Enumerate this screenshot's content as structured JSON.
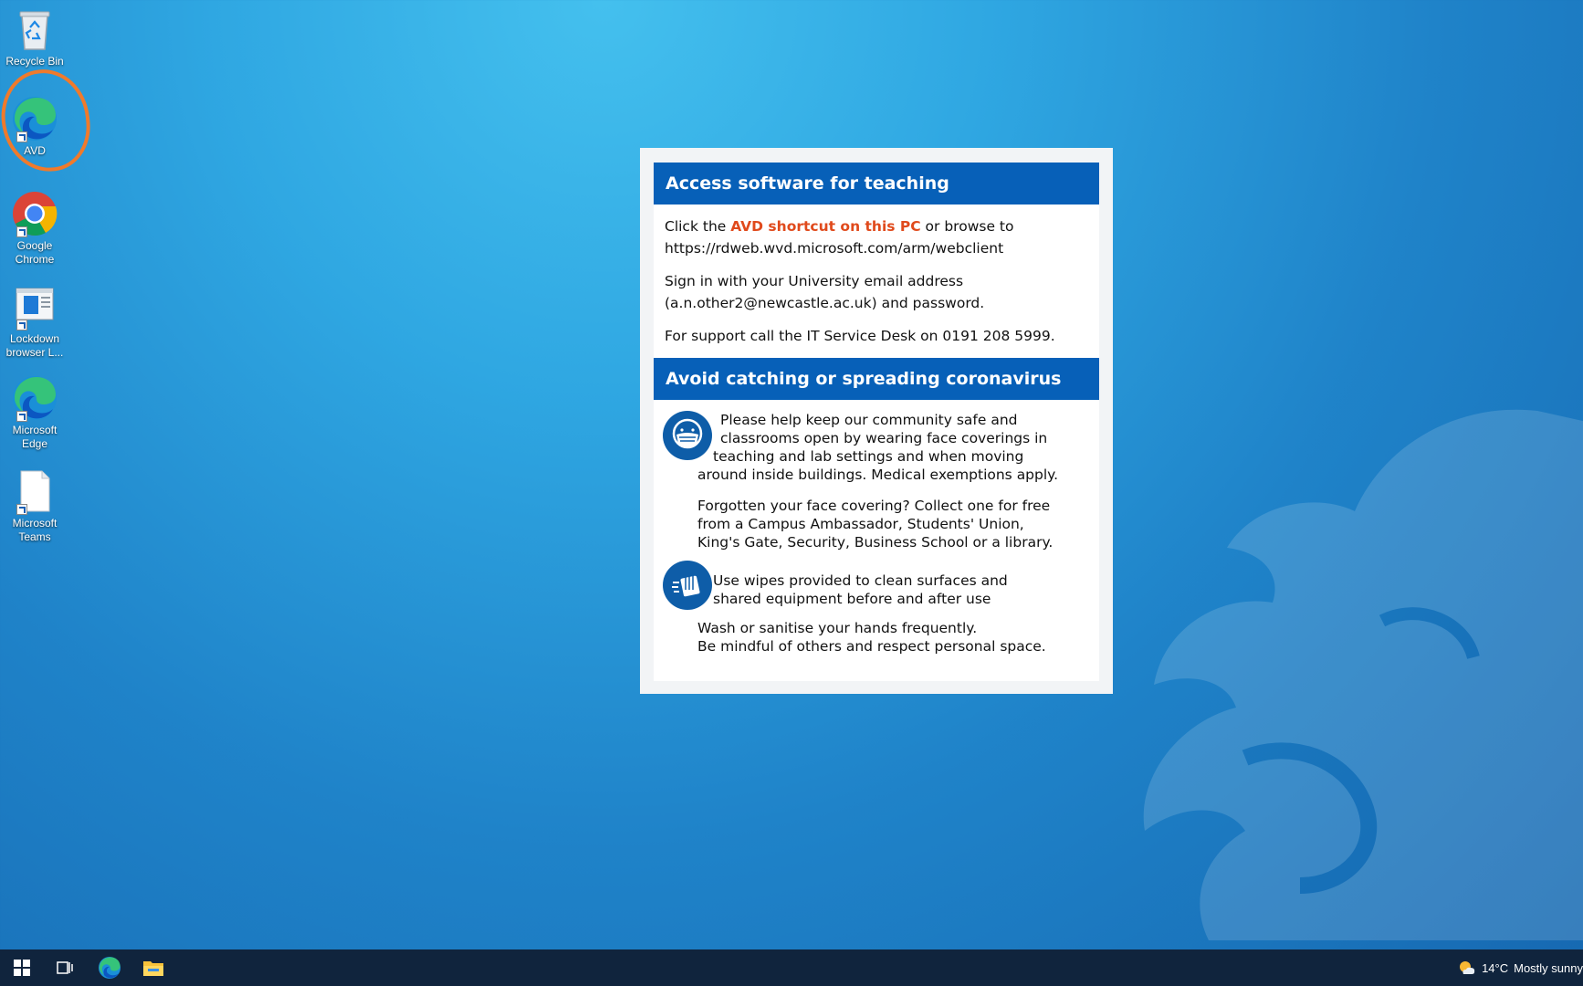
{
  "desktop": {
    "icons": [
      {
        "label": "Recycle Bin",
        "icon": "recycle-bin-icon"
      },
      {
        "label": "AVD",
        "icon": "edge-icon"
      },
      {
        "label": "Google Chrome",
        "icon": "chrome-icon"
      },
      {
        "label": "Lockdown browser L...",
        "icon": "lockdown-browser-icon"
      },
      {
        "label": "Microsoft Edge",
        "icon": "edge-icon"
      },
      {
        "label": "Microsoft Teams",
        "icon": "blank-document-icon"
      }
    ],
    "highlight_color": "#f07a2b"
  },
  "notice": {
    "section1": {
      "title": "Access software for teaching",
      "line1_pre": "Click the ",
      "line1_accent": "AVD shortcut on this PC",
      "line1_post": " or browse to",
      "url": "https://rdweb.wvd.microsoft.com/arm/webclient",
      "signin_line1": "Sign in with your University email address",
      "signin_line2": "(a.n.other2@newcastle.ac.uk) and password.",
      "support": "For support call the IT Service Desk on 0191 208 5999."
    },
    "section2": {
      "title": "Avoid catching or spreading coronavirus",
      "mask_p1": "Please help keep our community safe and",
      "mask_p2": "classrooms open by wearing face coverings in",
      "mask_p3": "teaching and lab settings and when moving",
      "mask_p4": "around inside buildings. Medical exemptions apply.",
      "forgot_1": "Forgotten your face covering? Collect one for free",
      "forgot_2": "from a Campus Ambassador, Students' Union,",
      "forgot_3": "King's Gate, Security, Business School or a library.",
      "wipes_1": "Use wipes provided to clean surfaces and",
      "wipes_2": "shared equipment before and after use",
      "wash_1": "Wash or sanitise your hands frequently.",
      "wash_2": "Be mindful of others and respect personal space."
    },
    "header_color": "#0760b8",
    "accent_color": "#e04a1c"
  },
  "taskbar": {
    "weather_temp": "14°C",
    "weather_text": "Mostly sunny"
  }
}
